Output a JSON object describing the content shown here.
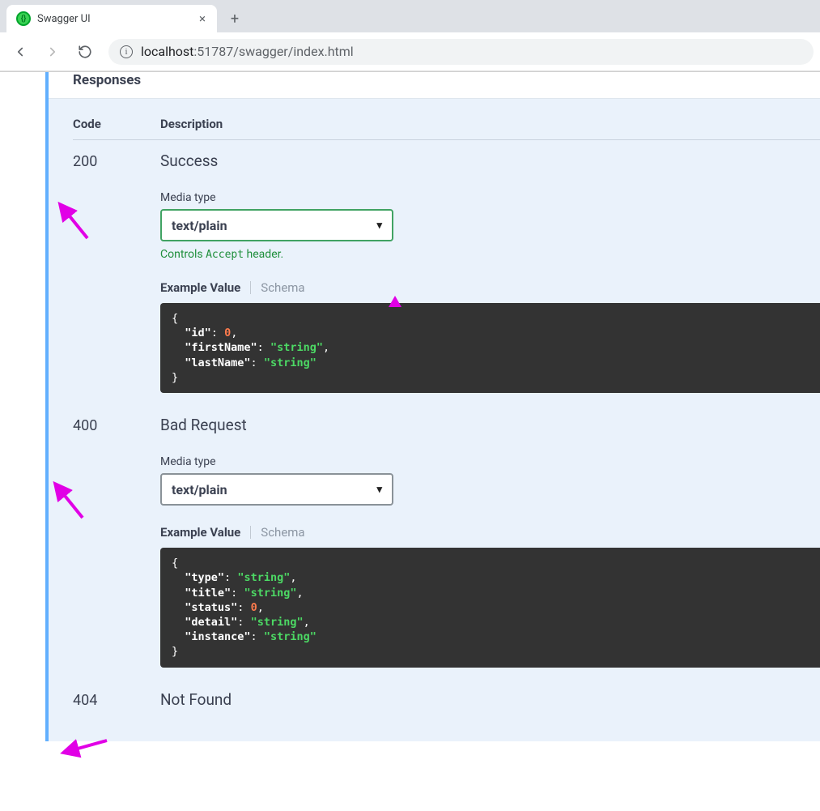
{
  "browser": {
    "tab_title": "Swagger UI",
    "url_host": "localhost",
    "url_port": ":51787",
    "url_path": "/swagger/index.html"
  },
  "section_title": "Responses",
  "columns": {
    "code": "Code",
    "description": "Description"
  },
  "responses": [
    {
      "code": "200",
      "title": "Success",
      "media_label": "Media type",
      "media_value": "text/plain",
      "accept_hint_prefix": "Controls ",
      "accept_hint_mono": "Accept",
      "accept_hint_suffix": " header.",
      "example_tab": "Example Value",
      "schema_tab": "Schema",
      "example_html": "{\n  <span class='tok-key'>\"id\"</span><span class='tok-punct'>:</span> <span class='tok-num'>0</span><span class='tok-punct'>,</span>\n  <span class='tok-key'>\"firstName\"</span><span class='tok-punct'>:</span> <span class='tok-str'>\"string\"</span><span class='tok-punct'>,</span>\n  <span class='tok-key'>\"lastName\"</span><span class='tok-punct'>:</span> <span class='tok-str'>\"string\"</span>\n}",
      "highlighted_select": true
    },
    {
      "code": "400",
      "title": "Bad Request",
      "media_label": "Media type",
      "media_value": "text/plain",
      "example_tab": "Example Value",
      "schema_tab": "Schema",
      "example_html": "{\n  <span class='tok-key'>\"type\"</span><span class='tok-punct'>:</span> <span class='tok-str'>\"string\"</span><span class='tok-punct'>,</span>\n  <span class='tok-key'>\"title\"</span><span class='tok-punct'>:</span> <span class='tok-str'>\"string\"</span><span class='tok-punct'>,</span>\n  <span class='tok-key'>\"status\"</span><span class='tok-punct'>:</span> <span class='tok-num'>0</span><span class='tok-punct'>,</span>\n  <span class='tok-key'>\"detail\"</span><span class='tok-punct'>:</span> <span class='tok-str'>\"string\"</span><span class='tok-punct'>,</span>\n  <span class='tok-key'>\"instance\"</span><span class='tok-punct'>:</span> <span class='tok-str'>\"string\"</span>\n}",
      "highlighted_select": false
    },
    {
      "code": "404",
      "title": "Not Found"
    }
  ],
  "annotations": {
    "color": "#e100e6"
  }
}
